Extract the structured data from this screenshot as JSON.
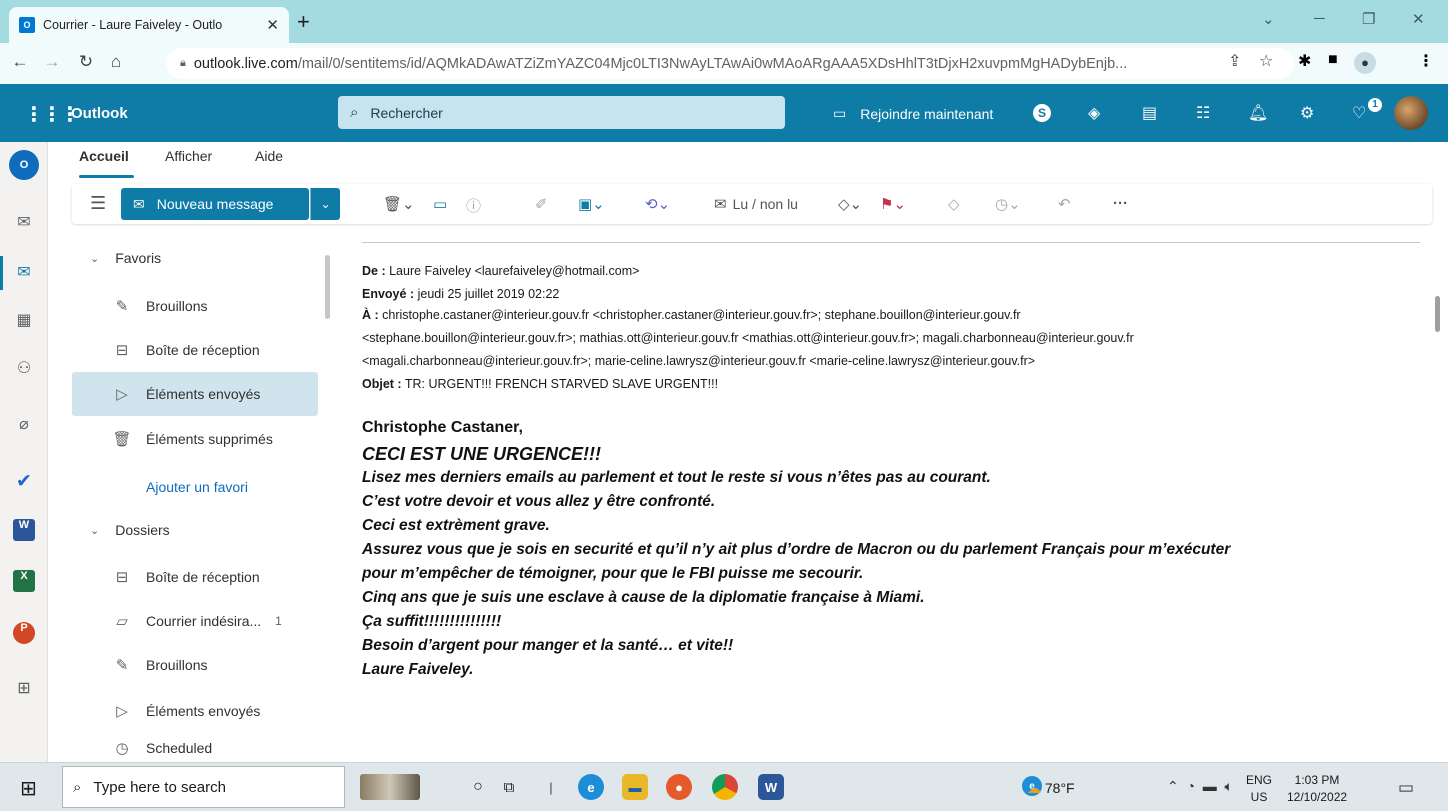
{
  "browser": {
    "tab_title": "Courrier - Laure Faiveley - Outlo",
    "url_host": "outlook.live.com",
    "url_path": "/mail/0/sentitems/id/AQMkADAwATZiZmYAZC04Mjc0LTI3NwAyLTAwAi0wMAoARgAAA5XDsHhlT3tDjxH2xuvpmMgHADybEnjb..."
  },
  "outlook": {
    "brand": "Outlook",
    "search_placeholder": "Rechercher",
    "join_label": "Rejoindre maintenant",
    "badge_count": "1"
  },
  "ribbon": {
    "tabs": [
      "Accueil",
      "Afficher",
      "Aide"
    ],
    "new_message": "Nouveau message",
    "read_unread": "Lu / non lu",
    "more": "···"
  },
  "folders": {
    "favorites_header": "Favoris",
    "favorites": [
      {
        "label": "Brouillons",
        "icon": "pencil-icon"
      },
      {
        "label": "Boîte de réception",
        "icon": "inbox-icon"
      },
      {
        "label": "Éléments envoyés",
        "icon": "send-icon"
      },
      {
        "label": "Éléments supprimés",
        "icon": "trash-icon"
      }
    ],
    "add_favorite": "Ajouter un favori",
    "folders_header": "Dossiers",
    "folders": [
      {
        "label": "Boîte de réception",
        "icon": "inbox-icon"
      },
      {
        "label": "Courrier indésira...",
        "icon": "junk-icon",
        "count": "1"
      },
      {
        "label": "Brouillons",
        "icon": "pencil-icon"
      },
      {
        "label": "Éléments envoyés",
        "icon": "send-icon"
      },
      {
        "label": "Scheduled",
        "icon": "clock-icon"
      }
    ]
  },
  "message": {
    "header": {
      "from_label": "De :",
      "from_value": "Laure Faiveley <laurefaiveley@hotmail.com>",
      "sent_label": "Envoyé :",
      "sent_value": "jeudi 25 juillet 2019 02:22",
      "to_label": "À :",
      "to_line1": "christophe.castaner@interieur.gouv.fr <christopher.castaner@interieur.gouv.fr>; stephane.bouillon@interieur.gouv.fr",
      "to_line2": "<stephane.bouillon@interieur.gouv.fr>; mathias.ott@interieur.gouv.fr <mathias.ott@interieur.gouv.fr>; magali.charbonneau@interieur.gouv.fr",
      "to_line3": "<magali.charbonneau@interieur.gouv.fr>; marie-celine.lawrysz@interieur.gouv.fr <marie-celine.lawrysz@interieur.gouv.fr>",
      "subject_label": "Objet :",
      "subject_value": "TR: URGENT!!! FRENCH STARVED SLAVE URGENT!!!"
    },
    "body": {
      "greeting": "Christophe Castaner,",
      "urgent": "CECI EST UNE URGENCE!!!",
      "lines": [
        "Lisez mes derniers emails au parlement et tout le reste si vous n’êtes pas au courant.",
        "C’est votre devoir et vous allez y être confronté.",
        "Ceci est extrèment grave.",
        "Assurez vous que je sois en securité et qu’il n’y ait plus d’ordre de Macron ou du parlement Français pour m’exécuter",
        "pour m’empêcher de témoigner, pour que le FBI puisse me secourir.",
        "Cinq ans que je suis une esclave à cause de la diplomatie française à Miami.",
        "Ça suffit!!!!!!!!!!!!!!!",
        "Besoin d’argent pour manger et la santé… et vite!!",
        "Laure Faiveley."
      ]
    }
  },
  "taskbar": {
    "search_placeholder": "Type here to search",
    "temperature": "78°F",
    "lang1": "ENG",
    "lang2": "US",
    "time": "1:03 PM",
    "date": "12/10/2022"
  }
}
